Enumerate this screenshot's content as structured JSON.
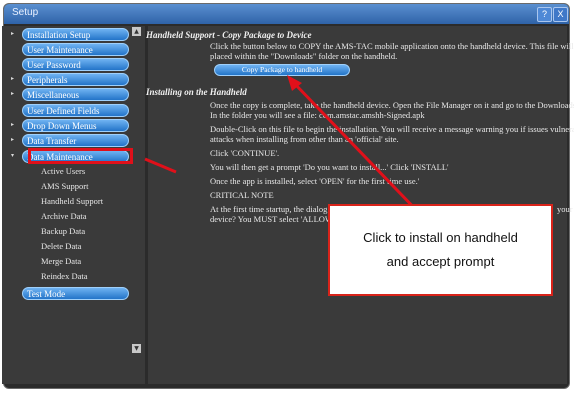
{
  "window": {
    "title": "Setup",
    "help_label": "?",
    "close_label": "X"
  },
  "sidebar": {
    "items": [
      {
        "label": "Installation Setup",
        "arrow": "▸"
      },
      {
        "label": "User Maintenance",
        "arrow": ""
      },
      {
        "label": "User Password",
        "arrow": ""
      },
      {
        "label": "Peripherals",
        "arrow": "▸"
      },
      {
        "label": "Miscellaneous",
        "arrow": "▸"
      },
      {
        "label": "User Defined Fields",
        "arrow": ""
      },
      {
        "label": "Drop Down Menus",
        "arrow": "▸"
      },
      {
        "label": "Data Transfer",
        "arrow": "▸"
      },
      {
        "label": "Data Maintenance",
        "arrow": "▾"
      }
    ],
    "subitems": [
      "Active Users",
      "AMS Support",
      "Handheld Support",
      "Archive Data",
      "Backup Data",
      "Delete Data",
      "Merge Data",
      "Reindex Data"
    ],
    "test_mode": "Test Mode"
  },
  "content": {
    "section1_title": "Handheld Support - Copy Package to Device",
    "section1_line1": "Click the button below to COPY the AMS-TAC mobile application onto the handheld device. This file will be",
    "section1_line2": "placed within the \"Downloads\" folder on the handheld.",
    "copy_button": "Copy Package to handheld",
    "section2_title": "Installing on the Handheld",
    "p1_line1": "Once the copy is complete, take the handheld device. Open the File Manager on it and go to the Downloads folder.",
    "p1_line2": "In the folder you will see a file: com.amstac.amshh-Signed.apk",
    "p2_line1": "Double-Click on this file to begin the installation. You will receive a message warning you if issues vulnerable to",
    "p2_line2": "attacks when installing from other than an 'official' site.",
    "p3": "Click 'CONTINUE'.",
    "p4": "You will then get a prompt 'Do you want to install...' Click 'INSTALL'",
    "p5": "Once the app is installed, select 'OPEN' for the first time use.'",
    "p6": "CRITICAL NOTE",
    "p7_line1": "At the first time startup, the dialog will ask",
    "p7_line1_end": "your",
    "p7_line2": "device? You MUST select 'ALLOW', otherwise..."
  },
  "callout": {
    "line1": "Click to install on handheld",
    "line2": "and accept prompt"
  },
  "colors": {
    "accent": "#2374c8",
    "highlight": "#e0101a"
  }
}
